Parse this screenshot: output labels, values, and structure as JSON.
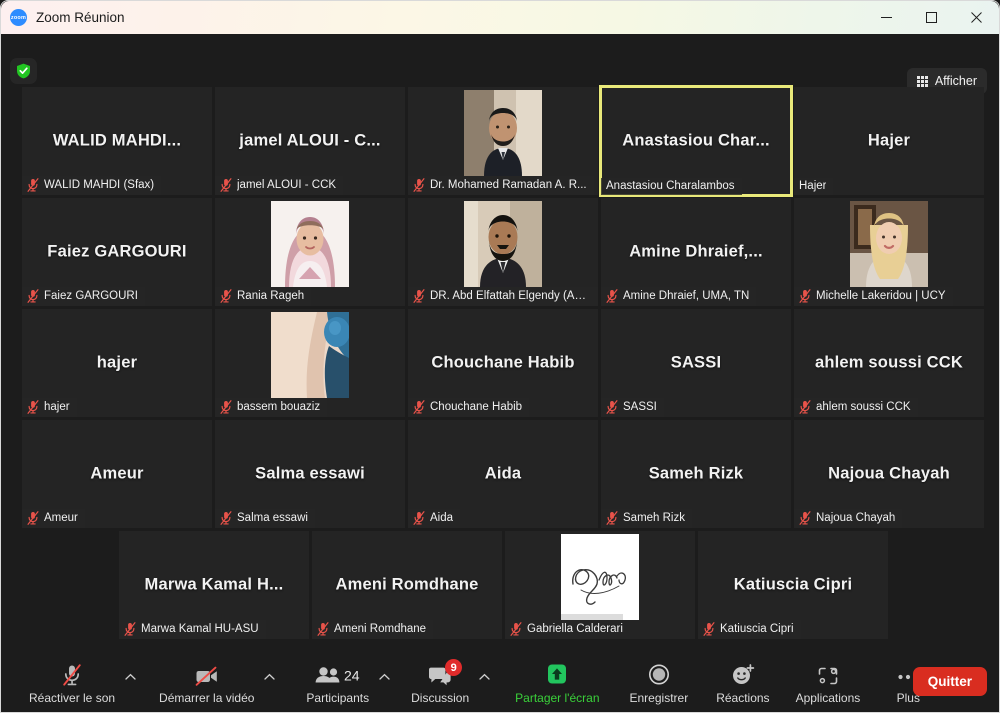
{
  "window": {
    "title": "Zoom Réunion",
    "logo_text": "zoom",
    "minimize_icon": "minimize-icon",
    "maximize_icon": "maximize-icon",
    "close_icon": "close-icon"
  },
  "topbar": {
    "shield_icon": "shield-check-icon",
    "view_label": "Afficher",
    "view_icon": "grid-icon"
  },
  "gallery": {
    "rows": [
      {
        "offset": 21,
        "tiles": [
          {
            "display_name": "WALID  MAHDI...",
            "footer": "WALID MAHDI (Sfax)",
            "muted": true,
            "photo": "none"
          },
          {
            "display_name": "jamel ALOUI - C...",
            "footer": "jamel ALOUI - CCK",
            "muted": true,
            "photo": "none"
          },
          {
            "display_name": "",
            "footer": "Dr. Mohamed Ramadan A. R...",
            "muted": true,
            "photo": "man-suit"
          },
          {
            "display_name": "Anastasiou  Char...",
            "footer": "Anastasiou Charalambos",
            "muted": false,
            "photo": "none",
            "active_speaker": true
          },
          {
            "display_name": "Hajer",
            "footer": "Hajer",
            "muted": false,
            "photo": "none"
          }
        ]
      },
      {
        "offset": 21,
        "tiles": [
          {
            "display_name": "Faiez GARGOURI",
            "footer": "Faiez GARGOURI",
            "muted": true,
            "photo": "none"
          },
          {
            "display_name": "",
            "footer": "Rania Rageh",
            "muted": true,
            "photo": "woman-hijab"
          },
          {
            "display_name": "",
            "footer": "DR. Abd Elfattah Elgendy (AS...",
            "muted": true,
            "photo": "man-beard"
          },
          {
            "display_name": "Amine  Dhraief,...",
            "footer": "Amine Dhraief, UMA, TN",
            "muted": true,
            "photo": "none"
          },
          {
            "display_name": "",
            "footer": "Michelle Lakeridou | UCY",
            "muted": true,
            "photo": "woman-blonde"
          }
        ]
      },
      {
        "offset": 21,
        "tiles": [
          {
            "display_name": "hajer",
            "footer": "hajer",
            "muted": true,
            "photo": "none"
          },
          {
            "display_name": "",
            "footer": "bassem bouaziz",
            "muted": true,
            "photo": "closeup-blue"
          },
          {
            "display_name": "Chouchane Habib",
            "footer": "Chouchane Habib",
            "muted": true,
            "photo": "none"
          },
          {
            "display_name": "SASSI",
            "footer": "SASSI",
            "muted": true,
            "photo": "none"
          },
          {
            "display_name": "ahlem soussi CCK",
            "footer": "ahlem soussi CCK",
            "muted": true,
            "photo": "none"
          }
        ]
      },
      {
        "offset": 21,
        "tiles": [
          {
            "display_name": "Ameur",
            "footer": "Ameur",
            "muted": true,
            "photo": "none"
          },
          {
            "display_name": "Salma essawi",
            "footer": "Salma essawi",
            "muted": true,
            "photo": "none"
          },
          {
            "display_name": "Aida",
            "footer": "Aida",
            "muted": true,
            "photo": "none"
          },
          {
            "display_name": "Sameh Rizk",
            "footer": "Sameh Rizk",
            "muted": true,
            "photo": "none"
          },
          {
            "display_name": "Najoua Chayah",
            "footer": "Najoua Chayah",
            "muted": true,
            "photo": "none"
          }
        ]
      },
      {
        "offset": 118,
        "tiles": [
          {
            "display_name": "Marwa  Kamal  H...",
            "footer": "Marwa Kamal HU-ASU",
            "muted": true,
            "photo": "none"
          },
          {
            "display_name": "Ameni Romdhane",
            "footer": "Ameni Romdhane",
            "muted": true,
            "photo": "none"
          },
          {
            "display_name": "",
            "footer": "Gabriella Calderari",
            "muted": true,
            "photo": "signature-white"
          },
          {
            "display_name": "Katiuscia Cipri",
            "footer": "Katiuscia Cipri",
            "muted": true,
            "photo": "none"
          }
        ]
      }
    ]
  },
  "toolbar": {
    "unmute_label": "Réactiver le son",
    "unmute_icon": "microphone-muted-icon",
    "unmute_caret": "chevron-up-icon",
    "video_label": "Démarrer la vidéo",
    "video_icon": "camera-muted-icon",
    "video_caret": "chevron-up-icon",
    "participants_label": "Participants",
    "participants_icon": "people-icon",
    "participants_count": "24",
    "participants_caret": "chevron-up-icon",
    "chat_label": "Discussion",
    "chat_icon": "chat-bubble-icon",
    "chat_badge": "9",
    "chat_caret": "chevron-up-icon",
    "share_label": "Partager l'écran",
    "share_icon": "share-screen-icon",
    "record_label": "Enregistrer",
    "record_icon": "record-circle-icon",
    "reactions_label": "Réactions",
    "reactions_icon": "smiley-plus-icon",
    "apps_label": "Applications",
    "apps_icon": "apps-bracket-icon",
    "more_label": "Plus",
    "more_icon": "ellipsis-icon",
    "leave_label": "Quitter"
  },
  "colors": {
    "accent_green": "#3ad13a",
    "leave_red": "#d92d20",
    "mute_red": "#e8534a",
    "active_border": "#e9e97a",
    "badge_red": "#e02b2b"
  }
}
